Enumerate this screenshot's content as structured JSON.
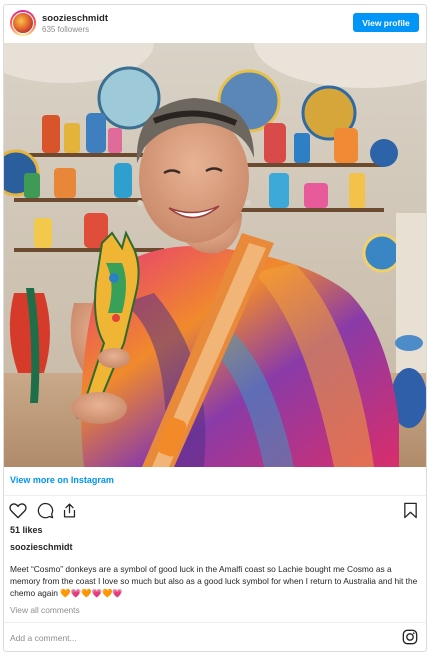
{
  "header": {
    "username": "soozieschmidt",
    "followers": "635 followers",
    "view_profile_label": "View profile"
  },
  "photo": {
    "description_alt": "Woman holding a colourful ceramic donkey in a pottery shop"
  },
  "links": {
    "view_more": "View more on Instagram"
  },
  "actions": {
    "icons": [
      "heart-icon",
      "comment-icon",
      "share-icon",
      "bookmark-icon"
    ]
  },
  "post": {
    "likes": "51 likes",
    "owner": "soozieschmidt",
    "caption": "Meet “Cosmo” donkeys are a symbol of good luck in the Amalfi coast so Lachie bought me Cosmo as a memory from the coast I love so much but also as a good luck symbol for when I return to Australia and hit the chemo again 🧡💗🧡💗🧡💗",
    "view_all_comments": "View all comments"
  },
  "comment": {
    "placeholder": "Add a comment..."
  },
  "colors": {
    "accent": "#0095f6",
    "muted": "#8e8e8e",
    "text": "#262626"
  }
}
